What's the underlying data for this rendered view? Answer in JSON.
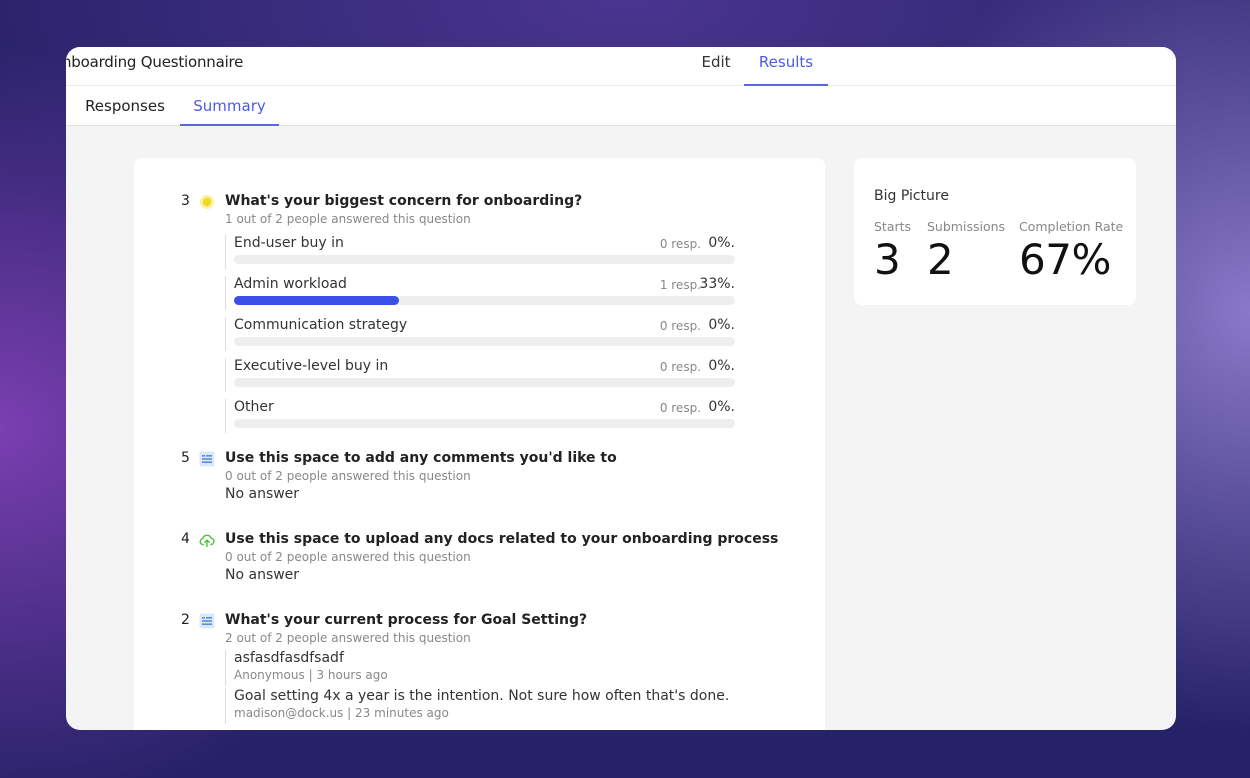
{
  "header": {
    "title": "nboarding Questionnaire",
    "tabs": [
      {
        "label": "Edit",
        "active": false
      },
      {
        "label": "Results",
        "active": true
      }
    ]
  },
  "subnav": {
    "tabs": [
      {
        "label": "Responses",
        "active": false
      },
      {
        "label": "Summary",
        "active": true
      }
    ]
  },
  "questions": [
    {
      "number": "3",
      "icon": "multiple-choice-icon",
      "title": "What's your biggest concern for onboarding?",
      "stats": "1 out of 2 people answered this question",
      "options": [
        {
          "label": "End-user buy in",
          "resp": "0 resp.",
          "pct": "0%.",
          "fraction": 0
        },
        {
          "label": "Admin workload",
          "resp": "1 resp.",
          "pct": "33%.",
          "fraction": 0.33
        },
        {
          "label": "Communication strategy",
          "resp": "0 resp.",
          "pct": "0%.",
          "fraction": 0
        },
        {
          "label": "Executive-level buy in",
          "resp": "0 resp.",
          "pct": "0%.",
          "fraction": 0
        },
        {
          "label": "Other",
          "resp": "0 resp.",
          "pct": "0%.",
          "fraction": 0
        }
      ]
    },
    {
      "number": "5",
      "icon": "text-answer-icon",
      "title": "Use this space to add any comments you'd like to",
      "stats": "0 out of 2 people answered this question",
      "no_answer": "No answer"
    },
    {
      "number": "4",
      "icon": "upload-cloud-icon",
      "title": "Use this space to upload any docs related to your onboarding process",
      "stats": "0 out of 2 people answered this question",
      "no_answer": "No answer"
    },
    {
      "number": "2",
      "icon": "text-answer-icon",
      "title": "What's your current process for Goal Setting?",
      "stats": "2 out of 2 people answered this question",
      "answers": [
        {
          "text": "asfasdfasdfsadf",
          "meta": "Anonymous | 3 hours ago"
        },
        {
          "text": "Goal setting 4x a year is the intention. Not sure how often that's done.",
          "meta": "madison@dock.us | 23 minutes ago"
        }
      ]
    }
  ],
  "big_picture": {
    "title": "Big Picture",
    "stats": [
      {
        "label": "Starts",
        "value": "3"
      },
      {
        "label": "Submissions",
        "value": "2"
      },
      {
        "label": "Completion Rate",
        "value": "67%"
      }
    ]
  },
  "colors": {
    "accent": "#4b5ae8",
    "bar_fill": "#3a4fe6",
    "choice_icon": "#f3e12a",
    "text_icon": "#5b8fd9",
    "upload_icon": "#4cc23a"
  }
}
